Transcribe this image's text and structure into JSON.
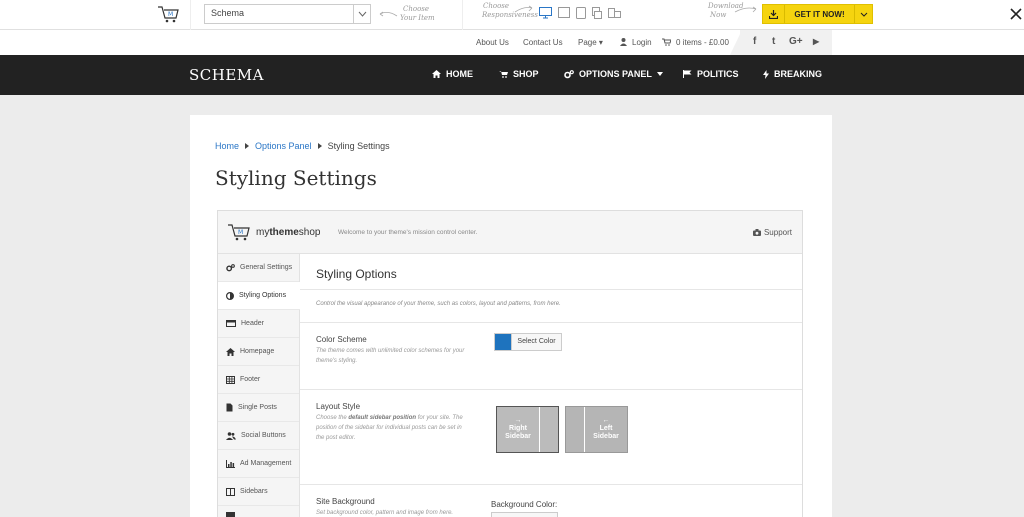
{
  "demobar": {
    "theme_select_value": "Schema",
    "hint_choose_item": [
      "Choose",
      "Your Item"
    ],
    "hint_choose_resp": [
      "Choose",
      "Responsiveness"
    ],
    "hint_download": [
      "Download",
      "Now"
    ],
    "get_it_label": "GET IT NOW!"
  },
  "toplinks": {
    "about": "About Us",
    "contact": "Contact Us",
    "page": "Page ▾",
    "login": "Login",
    "cart": "0 items - £0.00"
  },
  "social": {
    "fb": "f",
    "tw": "t",
    "gp": "G+",
    "yt": "▶"
  },
  "nav": {
    "brand": "SCHEMA",
    "items": [
      {
        "label": "HOME",
        "icon": "home-icon"
      },
      {
        "label": "SHOP",
        "icon": "cart-icon"
      },
      {
        "label": "OPTIONS PANEL",
        "icon": "gears-icon"
      },
      {
        "label": "POLITICS",
        "icon": "flag-icon"
      },
      {
        "label": "BREAKING",
        "icon": "bolt-icon"
      }
    ]
  },
  "breadcrumb": {
    "home": "Home",
    "parent": "Options Panel",
    "current": "Styling Settings"
  },
  "page_title": "Styling Settings",
  "panel": {
    "logo_light": "my",
    "logo_bold": "theme",
    "logo_tail": "shop",
    "welcome": "Welcome to your theme's mission control center.",
    "support": "Support",
    "sidebar": [
      {
        "label": "General Settings",
        "icon": "gears-icon"
      },
      {
        "label": "Styling Options",
        "icon": "contrast-icon"
      },
      {
        "label": "Header",
        "icon": "header-icon"
      },
      {
        "label": "Homepage",
        "icon": "home-icon"
      },
      {
        "label": "Footer",
        "icon": "table-icon"
      },
      {
        "label": "Single Posts",
        "icon": "file-icon"
      },
      {
        "label": "Social Buttons",
        "icon": "users-icon"
      },
      {
        "label": "Ad Management",
        "icon": "chart-icon"
      },
      {
        "label": "Sidebars",
        "icon": "columns-icon"
      }
    ],
    "title": "Styling Options",
    "description": "Control the visual appearance of your theme, such as colors, layout and patterns, from here.",
    "color_scheme": {
      "label": "Color Scheme",
      "desc": "The theme comes with unlimited color schemes for your theme's styling.",
      "button": "Select Color",
      "swatch": "#1e73be"
    },
    "layout_style": {
      "label": "Layout Style",
      "desc_pre": "Choose the ",
      "desc_bold": "default sidebar position",
      "desc_post": " for your site. The position of the sidebar for individual posts can be set in the post editor.",
      "right_arrow": "→",
      "right_line1": "Right",
      "right_line2": "Sidebar",
      "left_arrow": "←",
      "left_line1": "Left",
      "left_line2": "Sidebar"
    },
    "site_background": {
      "label": "Site Background",
      "desc": "Set background color, pattern and image from here.",
      "bg_color_label": "Background Color:"
    }
  }
}
